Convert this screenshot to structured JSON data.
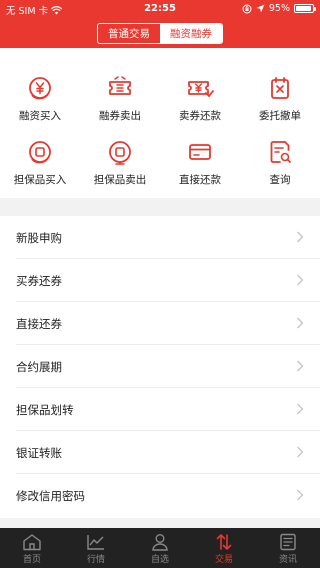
{
  "status_bar": {
    "carrier": "无 SIM 卡",
    "time": "22:55",
    "battery_percent": "95%",
    "battery_level": 0.95
  },
  "segmented": {
    "options": [
      "普通交易",
      "融资融券"
    ],
    "selected": "融资融券"
  },
  "grid": [
    {
      "label": "融资买入",
      "icon": "yen-circle-icon"
    },
    {
      "label": "融券卖出",
      "icon": "ticket-icon"
    },
    {
      "label": "卖券还款",
      "icon": "yen-ticket-icon"
    },
    {
      "label": "委托撤单",
      "icon": "cancel-order-icon"
    },
    {
      "label": "担保品买入",
      "icon": "collateral-buy-icon"
    },
    {
      "label": "担保品卖出",
      "icon": "collateral-sell-icon"
    },
    {
      "label": "直接还款",
      "icon": "card-repay-icon"
    },
    {
      "label": "查询",
      "icon": "query-icon"
    }
  ],
  "list": [
    {
      "label": "新股申购"
    },
    {
      "label": "买券还券"
    },
    {
      "label": "直接还券"
    },
    {
      "label": "合约展期"
    },
    {
      "label": "担保品划转"
    },
    {
      "label": "银证转账"
    },
    {
      "label": "修改信用密码"
    }
  ],
  "tabs": [
    {
      "label": "首页",
      "icon": "home-icon"
    },
    {
      "label": "行情",
      "icon": "chart-icon"
    },
    {
      "label": "自选",
      "icon": "person-icon"
    },
    {
      "label": "交易",
      "icon": "trade-icon",
      "active": true
    },
    {
      "label": "资讯",
      "icon": "news-icon"
    }
  ],
  "colors": {
    "brand": "#e8382f",
    "tab_bar": "#222222",
    "tab_inactive": "#8a8a8a",
    "background": "#f2f2f2"
  }
}
